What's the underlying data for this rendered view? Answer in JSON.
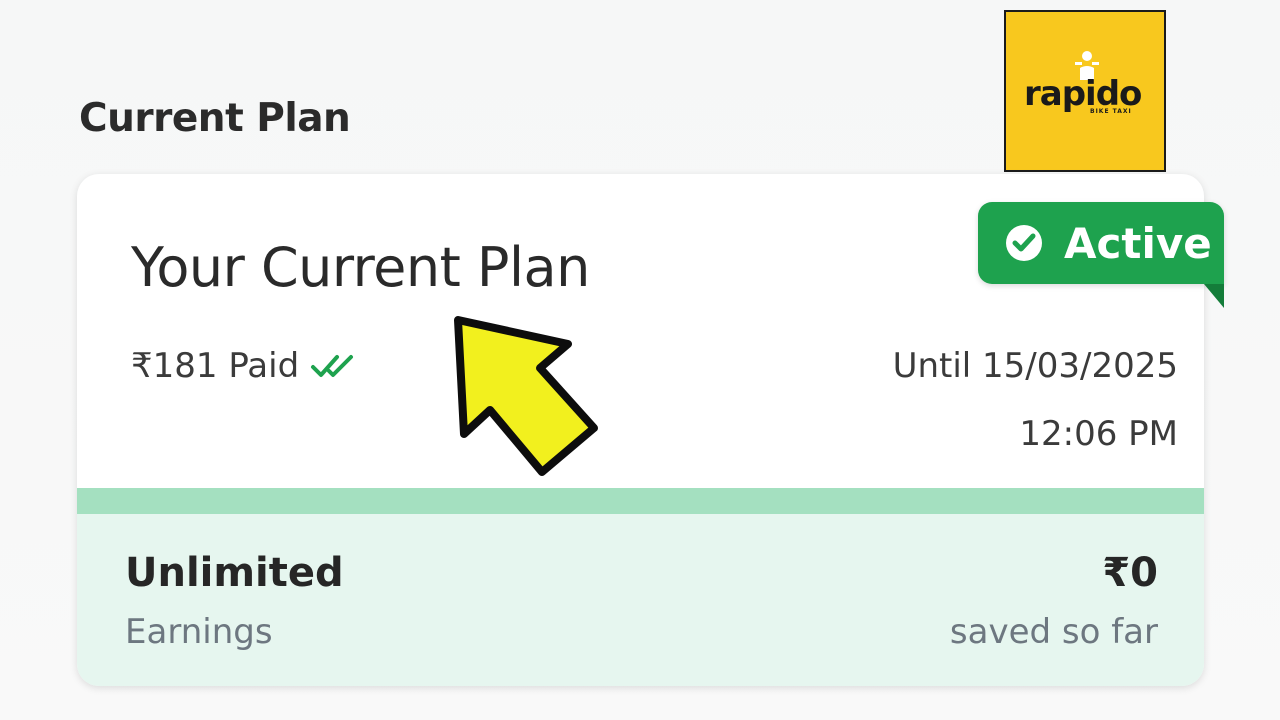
{
  "section": {
    "title": "Current Plan"
  },
  "logo": {
    "word": "rapido",
    "sub": "BIKE TAXI",
    "brand_color": "#f8c81e"
  },
  "card": {
    "title": "Your Current Plan",
    "paid_text": "₹181 Paid",
    "until_text": "Until 15/03/2025",
    "time_text": "12:06 PM",
    "badge_label": "Active",
    "badge_color": "#1ea24e",
    "unlimited_label": "Unlimited",
    "earnings_label": "Earnings",
    "amount": "₹0",
    "saved_label": "saved so far"
  },
  "icons": {
    "badge": "check-circle-icon",
    "paid": "double-check-icon",
    "pointer": "pointer-arrow-icon",
    "logo": "rider-icon"
  }
}
